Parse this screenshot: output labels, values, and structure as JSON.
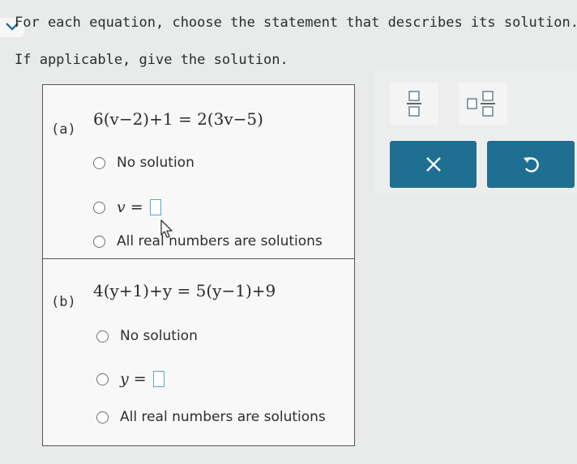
{
  "instructions": {
    "line1": "For each equation, choose the statement that describes its solution.",
    "line2": "If applicable, give the solution."
  },
  "part_a": {
    "label": "(a)",
    "equation": {
      "left": "6(v−2)+1",
      "equals": "=",
      "right": "2(3v−5)"
    },
    "options": {
      "no_solution": "No solution",
      "variable": "v",
      "equals": "=",
      "all_real": "All real numbers are solutions"
    }
  },
  "part_b": {
    "label": "(b)",
    "equation": {
      "left": "4(y+1)+y",
      "equals": "=",
      "right": "5(y−1)+9"
    },
    "options": {
      "no_solution": "No solution",
      "variable": "y",
      "equals": "=",
      "all_real": "All real numbers are solutions"
    }
  },
  "toolbar": {
    "icons": [
      "fraction-icon",
      "mixed-number-icon",
      "close-icon",
      "undo-icon"
    ],
    "accent": "#1f6f93"
  }
}
